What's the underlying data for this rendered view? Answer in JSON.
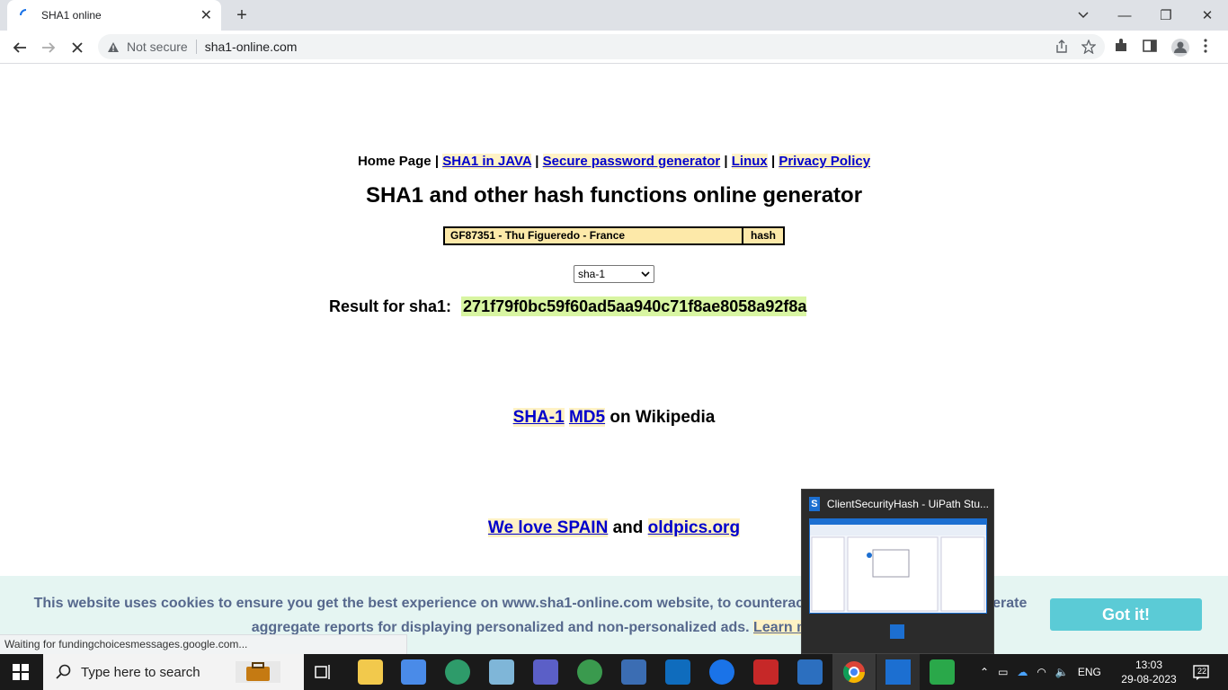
{
  "browser": {
    "tab_title": "SHA1 online",
    "security_label": "Not secure",
    "url": "sha1-online.com",
    "status_text": "Waiting for fundingchoicesmessages.google.com..."
  },
  "page": {
    "nav": {
      "home": "Home Page",
      "sep": "|",
      "links": [
        "SHA1 in JAVA",
        "Secure password generator",
        "Linux",
        "Privacy Policy"
      ]
    },
    "heading": "SHA1 and other hash functions online generator",
    "input_value": "GF87351 -  Thu Figueredo -  France",
    "hash_button": "hash",
    "algorithm": "sha-1",
    "result_label": "Result for sha1:",
    "result_value": "271f79f0bc59f60ad5aa940c71f8ae8058a92f8a",
    "wiki": {
      "link1": "SHA-1",
      "link2": "MD5",
      "suffix": "on Wikipedia"
    },
    "love": {
      "link1": "We love SPAIN",
      "mid": "and",
      "link2": "oldpics.org"
    },
    "cookie": {
      "line1": "This website uses cookies to ensure you get the best experience on www.sha1-online.com website, to counterac",
      "line1_end": "erate",
      "line2": "aggregate reports for displaying personalized and non-personalized ads.",
      "learn_more": "Learn m",
      "button": "Got it!"
    }
  },
  "thumbnail": {
    "title": "ClientSecurityHash - UiPath Stu..."
  },
  "taskbar": {
    "search_placeholder": "Type here to search",
    "language": "ENG",
    "time": "13:03",
    "date": "29-08-2023",
    "notifications": "22"
  },
  "colors": {
    "link": "#0000cc",
    "link_bg": "#fff2c5",
    "result_bg": "#d8f5a2",
    "cookie_bg": "#e5f5f2",
    "cookie_button": "#5bcbd6"
  }
}
